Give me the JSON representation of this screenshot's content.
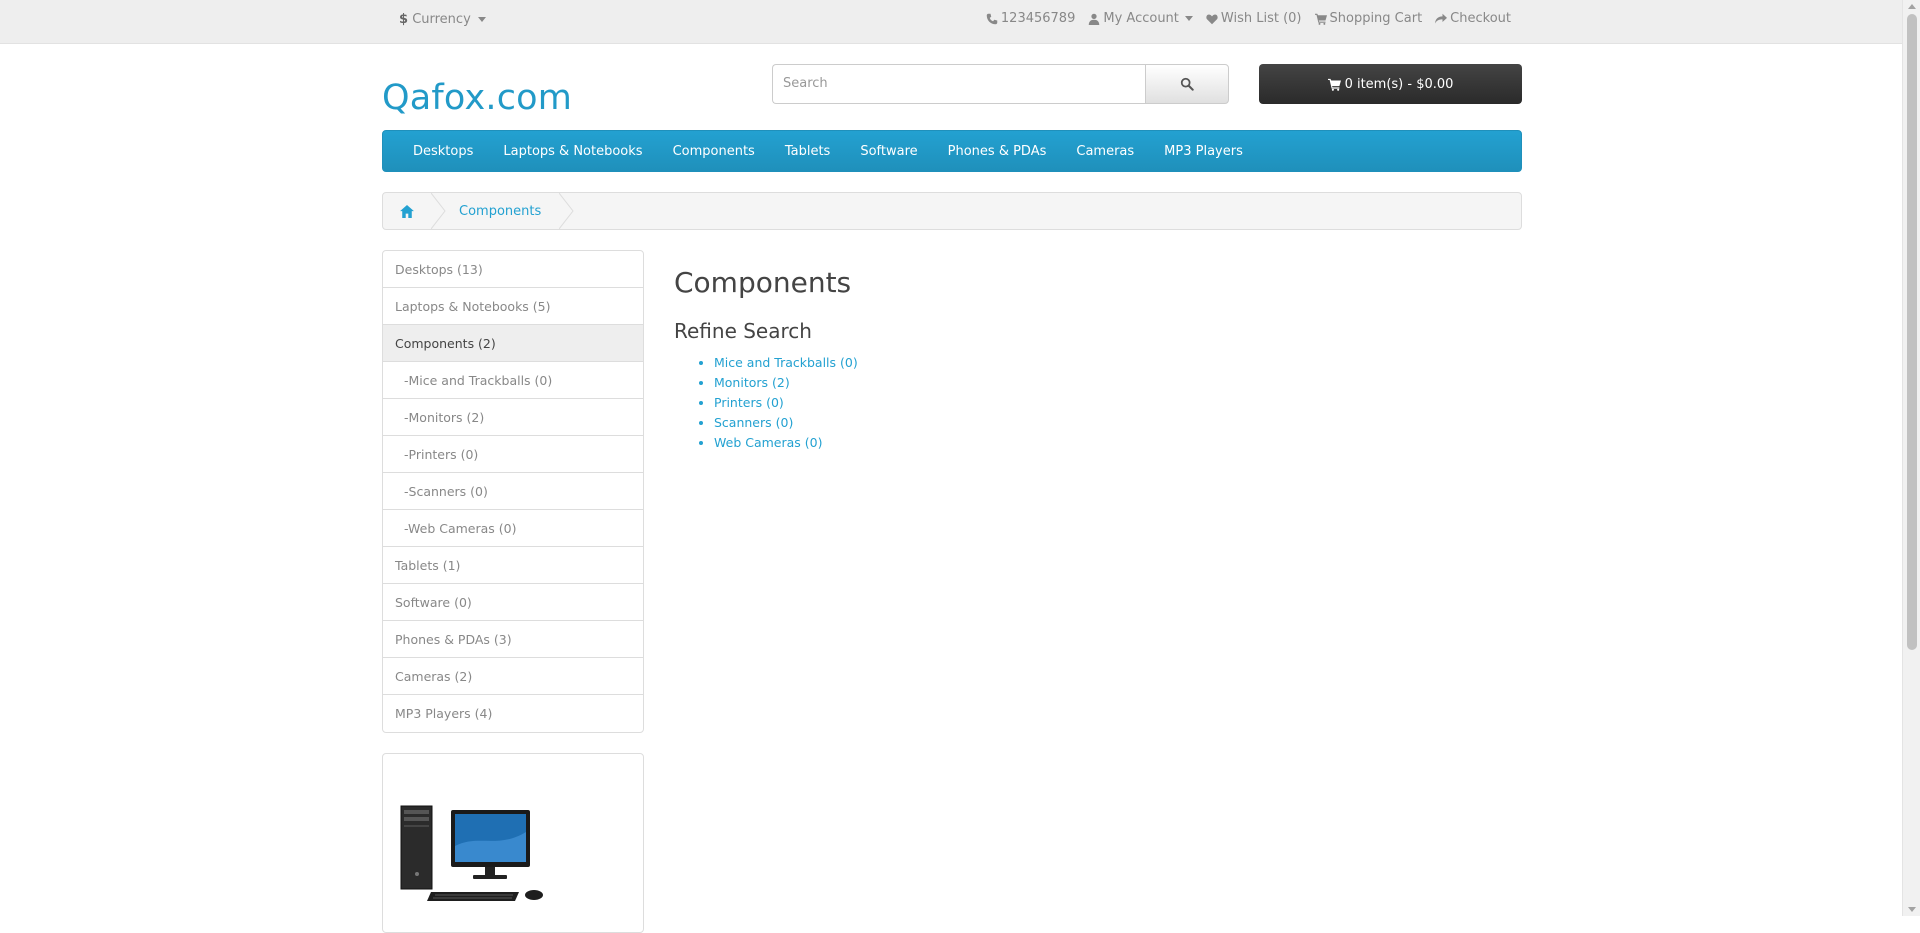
{
  "topbar": {
    "currency_symbol": "$",
    "currency_label": "Currency",
    "phone": "123456789",
    "my_account": "My Account",
    "wish_list": "Wish List (0)",
    "shopping_cart": "Shopping Cart",
    "checkout": "Checkout"
  },
  "header": {
    "logo": "Qafox.com",
    "search_placeholder": "Search",
    "cart_label": "0 item(s) - $0.00"
  },
  "menu": {
    "items": [
      "Desktops",
      "Laptops & Notebooks",
      "Components",
      "Tablets",
      "Software",
      "Phones & PDAs",
      "Cameras",
      "MP3 Players"
    ]
  },
  "breadcrumb": {
    "current": "Components"
  },
  "sidebar": {
    "items": [
      {
        "label": "Desktops (13)"
      },
      {
        "label": "Laptops & Notebooks (5)"
      },
      {
        "label": "Components (2)"
      },
      {
        "label": "-Mice and Trackballs (0)"
      },
      {
        "label": "-Monitors (2)"
      },
      {
        "label": "-Printers (0)"
      },
      {
        "label": "-Scanners (0)"
      },
      {
        "label": "-Web Cameras (0)"
      },
      {
        "label": "Tablets (1)"
      },
      {
        "label": "Software (0)"
      },
      {
        "label": "Phones & PDAs (3)"
      },
      {
        "label": "Cameras (2)"
      },
      {
        "label": "MP3 Players (4)"
      }
    ]
  },
  "main": {
    "title": "Components",
    "refine_title": "Refine Search",
    "refine_links": [
      "Mice and Trackballs (0)",
      "Monitors (2)",
      "Printers (0)",
      "Scanners (0)",
      "Web Cameras (0)"
    ]
  },
  "colors": {
    "accent": "#229ac8",
    "menu_bg": "#23a1d1",
    "cart_bg": "#363636",
    "topbar_bg": "#eeeeee"
  }
}
